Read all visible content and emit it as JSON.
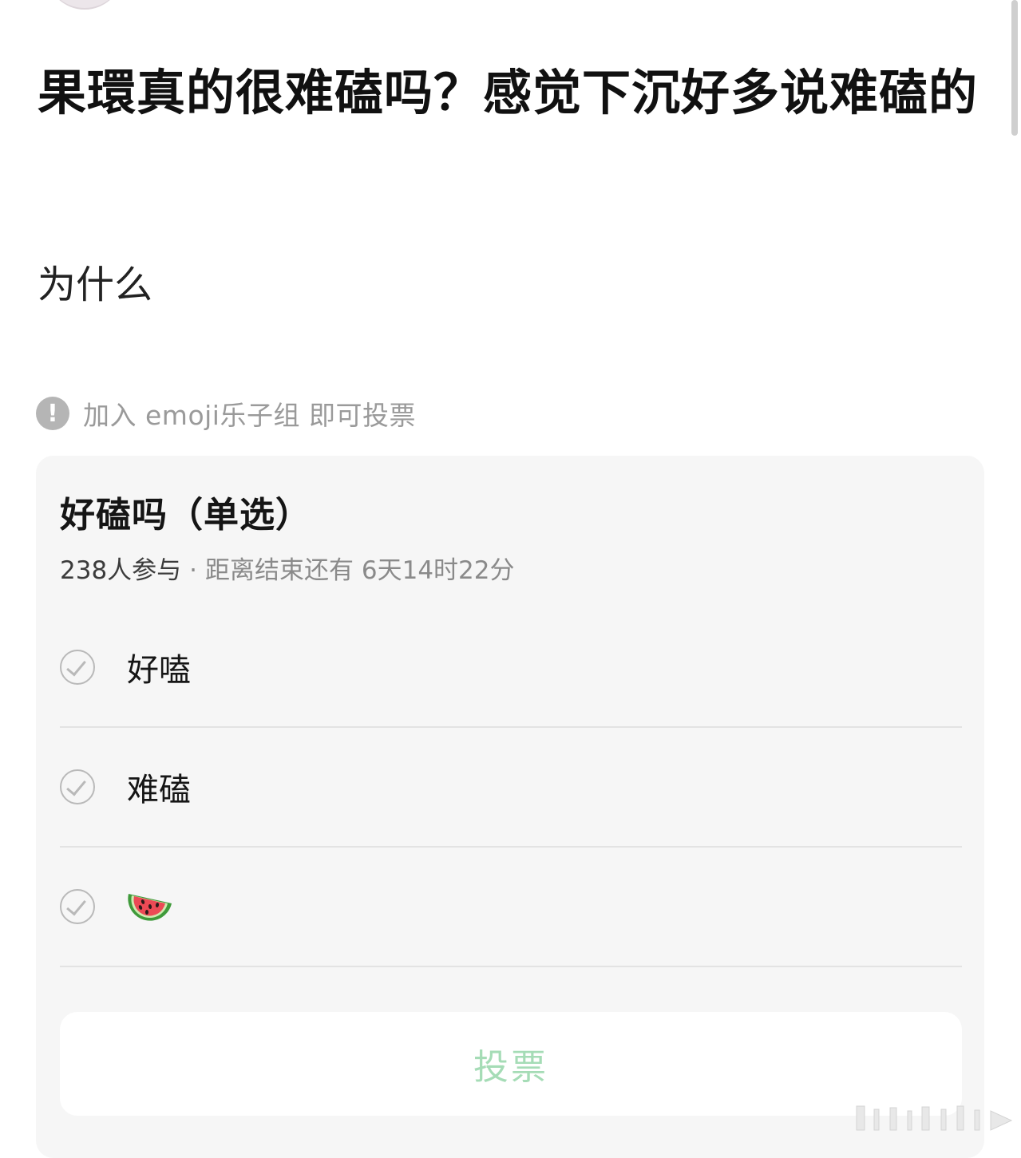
{
  "post": {
    "title": "果環真的很难磕吗？感觉下沉好多说难磕的",
    "body": "为什么"
  },
  "notice": {
    "text": "加入 emoji乐子组 即可投票",
    "icon": "exclamation-icon"
  },
  "poll": {
    "title": "好磕吗（单选）",
    "participants": "238人参与",
    "separator": "·",
    "deadline": "距离结束还有 6天14时22分",
    "options": [
      {
        "label": "好嗑",
        "icon": "checkmark-circle-icon"
      },
      {
        "label": "难磕",
        "icon": "checkmark-circle-icon"
      },
      {
        "label": "",
        "emoji": "watermelon",
        "icon": "checkmark-circle-icon"
      }
    ],
    "vote_button": "投票"
  },
  "colors": {
    "vote_button_text": "#a5dcb6",
    "card_background": "#f6f6f6",
    "notice_text": "#9a9a9a"
  }
}
